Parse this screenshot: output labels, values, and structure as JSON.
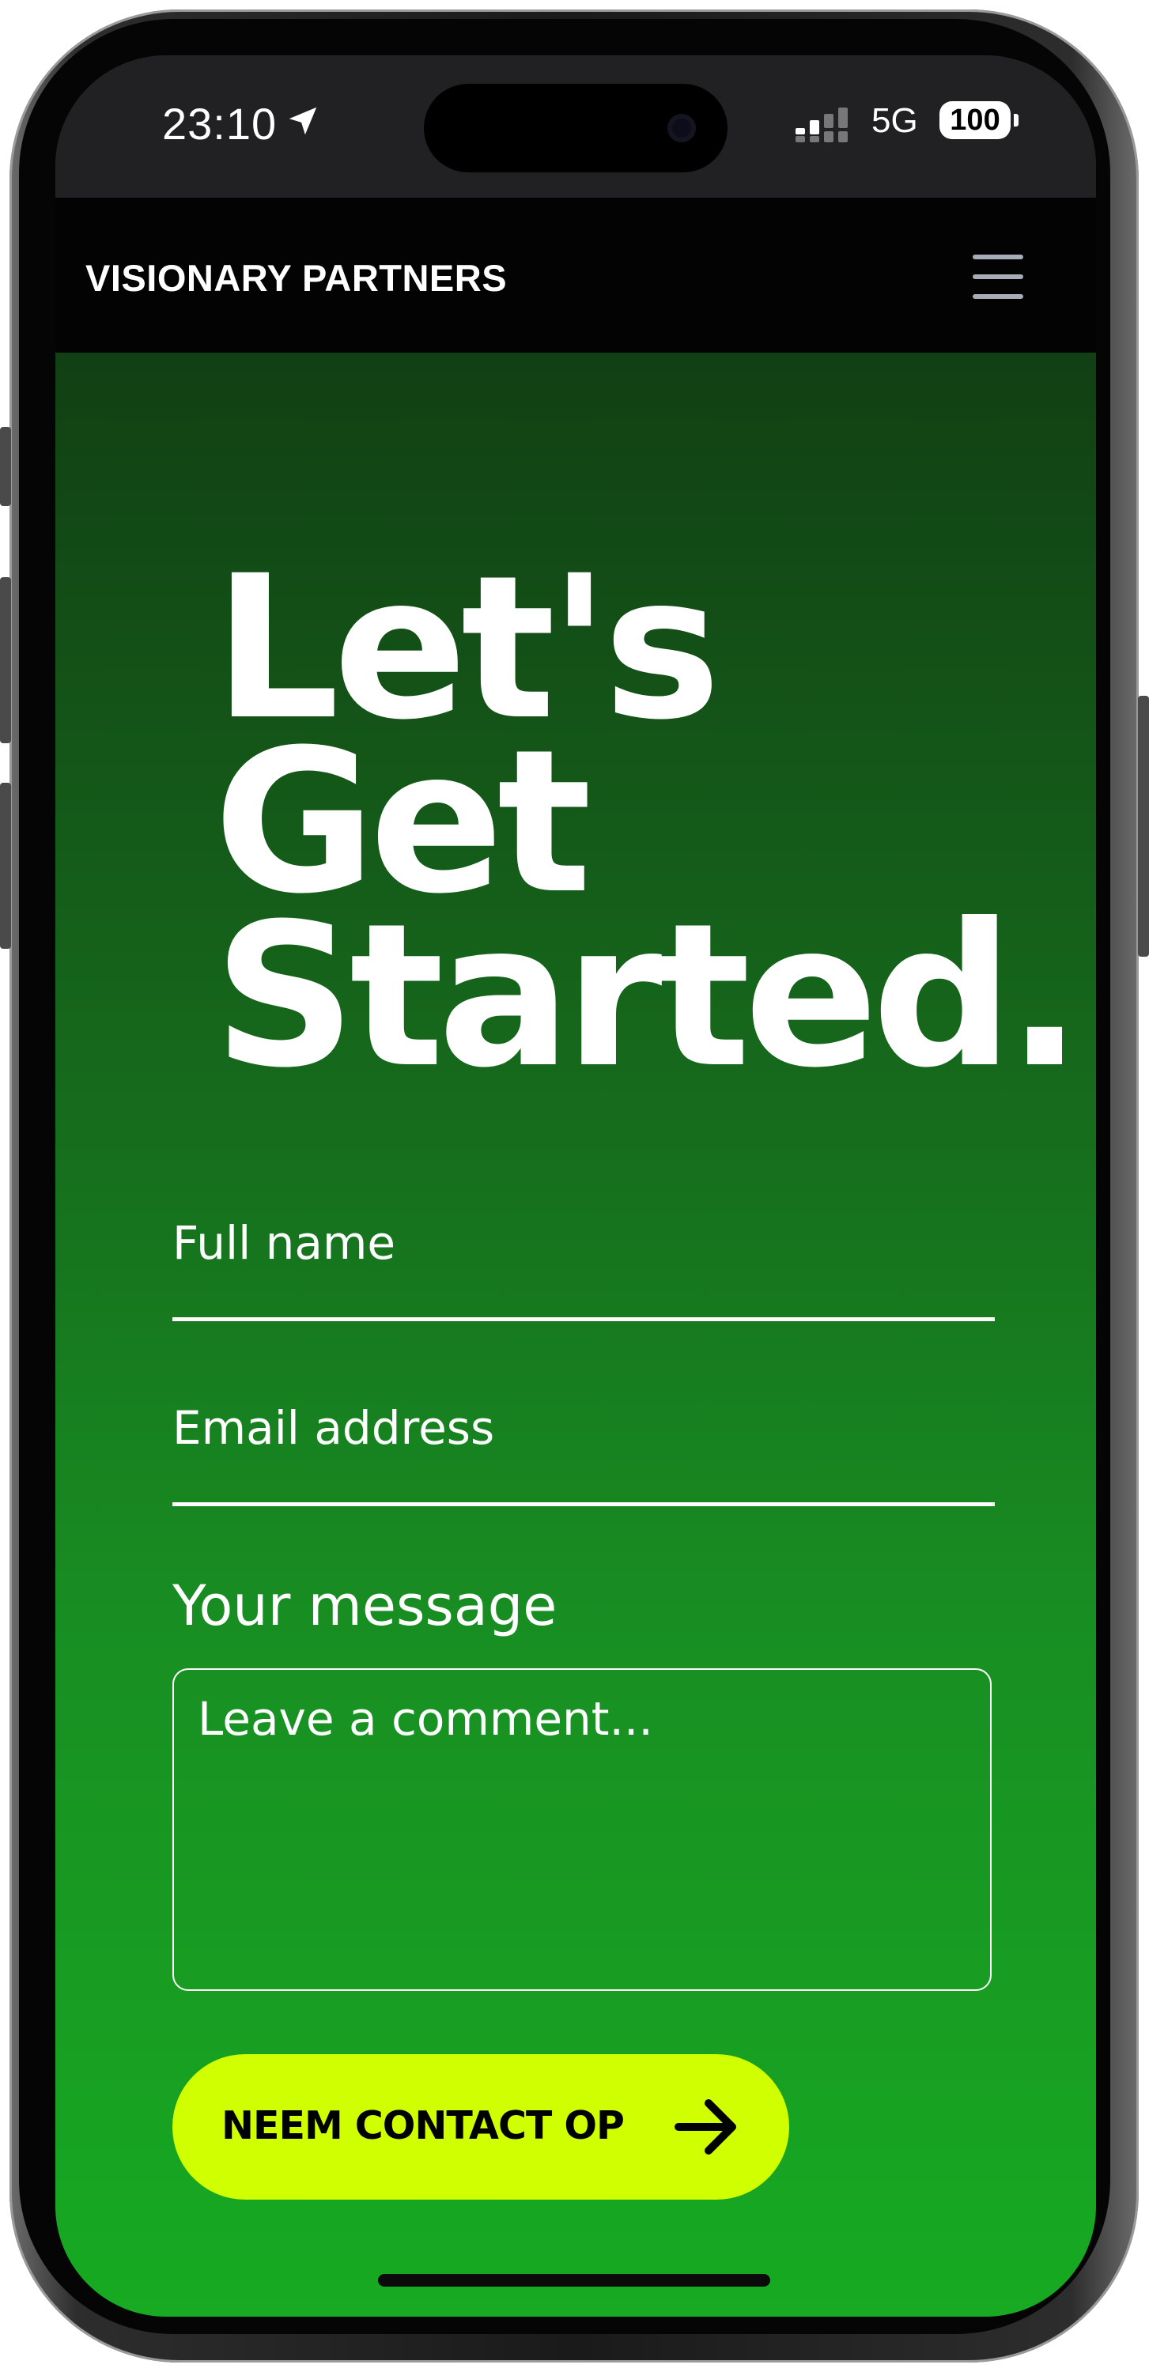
{
  "status_bar": {
    "time": "23:10",
    "network": "5G",
    "battery": "100"
  },
  "navbar": {
    "brand": "VISIONARY PARTNERS",
    "menu_icon": "hamburger-menu-icon"
  },
  "hero": {
    "heading_lines": [
      "Let's",
      "Get",
      "Started."
    ]
  },
  "form": {
    "full_name_placeholder": "Full name",
    "email_placeholder": "Email address",
    "message_label": "Your message",
    "message_placeholder": "Leave a comment...",
    "submit_label": "NEEM CONTACT OP",
    "submit_icon": "arrow-right-icon"
  },
  "colors": {
    "accent": "#cfff00",
    "background_top": "#0f2f10",
    "background_bottom": "#17aa22",
    "navbar": "#030303"
  }
}
